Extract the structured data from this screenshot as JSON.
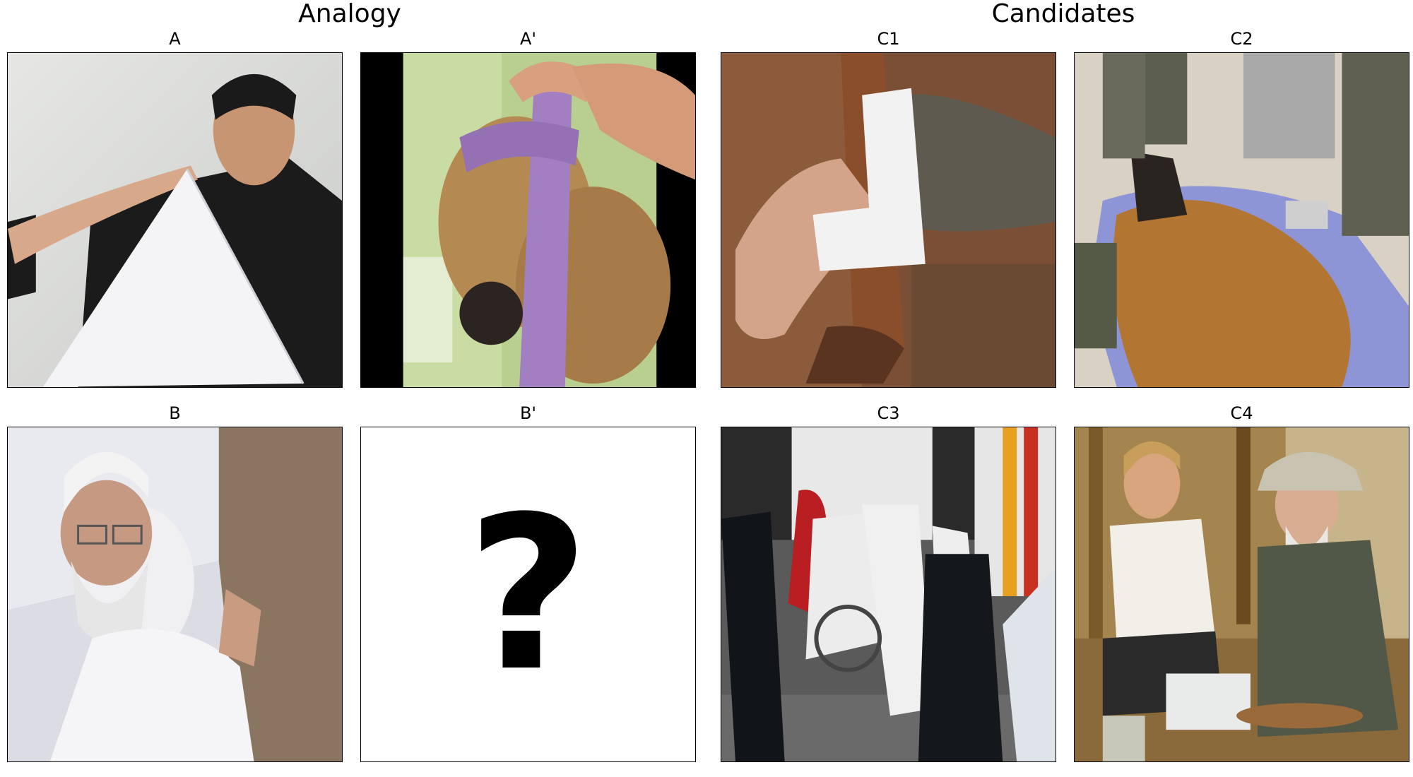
{
  "sections": {
    "analogy_title": "Analogy",
    "candidates_title": "Candidates"
  },
  "panels": {
    "A": {
      "label": "A",
      "image": "man-with-arm-sling-photo"
    },
    "A_prime": {
      "label": "A'",
      "image": "toy-dog-head-bandage-photo"
    },
    "B": {
      "label": "B",
      "image": "elderly-man-in-bed-photo"
    },
    "B_prime": {
      "label": "B'",
      "image": "question-mark",
      "symbol": "?"
    },
    "C1": {
      "label": "C1",
      "image": "dog-paw-bandage-photo"
    },
    "C2": {
      "label": "C2",
      "image": "dog-on-medical-table-photo"
    },
    "C3": {
      "label": "C3",
      "image": "hazmat-ambulance-scene-photo"
    },
    "C4": {
      "label": "C4",
      "image": "bandaging-old-man-hand-photo"
    }
  }
}
